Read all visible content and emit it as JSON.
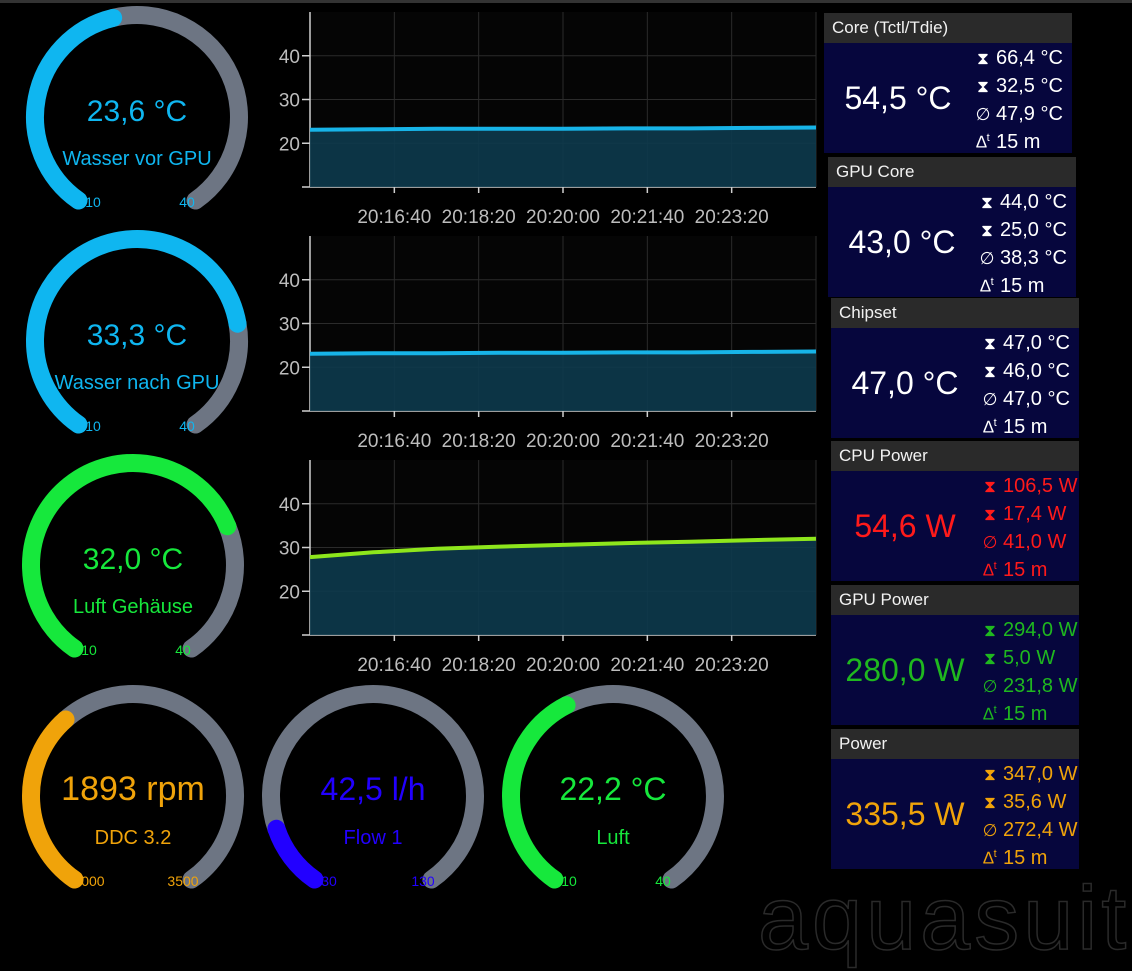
{
  "colors": {
    "blue": "#0fb6f0",
    "green": "#16e83c",
    "orange": "#f0a30a",
    "flow_blue": "#2200ff",
    "track": "#6d7583",
    "stat_white": "#ffffff",
    "stat_red": "#ff1a1a",
    "stat_green": "#1fb81f",
    "stat_orange": "#f0a30a",
    "chart_line_blue": "#17b4e8",
    "chart_line_green": "#8ee61c",
    "chart_fill": "#0d3a4c",
    "panel_bg": "#06063d",
    "panel_header": "#2a2a2a"
  },
  "gauges": [
    {
      "value_text": "23,6 °C",
      "label": "Wasser vor GPU",
      "min_label": "10",
      "max_label": "40",
      "min": 10,
      "max": 40,
      "value": 23.6,
      "color": "blue"
    },
    {
      "value_text": "33,3 °C",
      "label": "Wasser nach GPU",
      "min_label": "10",
      "max_label": "40",
      "min": 10,
      "max": 40,
      "value": 33.3,
      "color": "blue"
    },
    {
      "value_text": "32,0 °C",
      "label": "Luft Gehäuse",
      "min_label": "10",
      "max_label": "40",
      "min": 10,
      "max": 40,
      "value": 32.0,
      "color": "green"
    },
    {
      "value_text": "1893 rpm",
      "label": "DDC 3.2",
      "min_label": "1000",
      "max_label": "3500",
      "min": 1000,
      "max": 3500,
      "value": 1893,
      "color": "orange"
    },
    {
      "value_text": "42,5 l/h",
      "label": "Flow 1",
      "min_label": "30",
      "max_label": "130",
      "min": 30,
      "max": 130,
      "value": 42.5,
      "color": "flow_blue"
    },
    {
      "value_text": "22,2 °C",
      "label": "Luft",
      "min_label": "10",
      "max_label": "40",
      "min": 10,
      "max": 40,
      "value": 22.2,
      "color": "green"
    }
  ],
  "chart_data": [
    {
      "type": "area",
      "series": [
        {
          "values": [
            23.1,
            23.2,
            23.3,
            23.3,
            23.3,
            23.4,
            23.4,
            23.5,
            23.6
          ]
        }
      ],
      "x": [
        "20:15:00",
        "20:16:40",
        "20:18:20",
        "20:20:00",
        "20:21:40",
        "20:23:20",
        "20:25:00"
      ],
      "x_tick_labels": [
        "20:16:40",
        "20:18:20",
        "20:20:00",
        "20:21:40",
        "20:23:20"
      ],
      "y_tick_labels": [
        "20",
        "30",
        "40"
      ],
      "ylim": [
        10,
        50
      ],
      "grid": true,
      "line_color": "chart_line_blue"
    },
    {
      "type": "area",
      "series": [
        {
          "values": [
            23.1,
            23.2,
            23.2,
            23.3,
            23.3,
            23.4,
            23.4,
            23.5,
            23.6
          ]
        }
      ],
      "x_tick_labels": [
        "20:16:40",
        "20:18:20",
        "20:20:00",
        "20:21:40",
        "20:23:20"
      ],
      "y_tick_labels": [
        "20",
        "30",
        "40"
      ],
      "ylim": [
        10,
        50
      ],
      "grid": true,
      "line_color": "chart_line_blue"
    },
    {
      "type": "area",
      "series": [
        {
          "values": [
            27.8,
            28.9,
            29.7,
            30.2,
            30.6,
            31.0,
            31.3,
            31.7,
            32.0
          ]
        }
      ],
      "x_tick_labels": [
        "20:16:40",
        "20:18:20",
        "20:20:00",
        "20:21:40",
        "20:23:20"
      ],
      "y_tick_labels": [
        "20",
        "30",
        "40"
      ],
      "ylim": [
        10,
        50
      ],
      "grid": true,
      "line_color": "chart_line_green"
    }
  ],
  "panels": [
    {
      "title": "Core (Tctl/Tdie)",
      "value": "54,5 °C",
      "max": "66,4 °C",
      "min": "32,5 °C",
      "avg": "47,9 °C",
      "span": "15 m",
      "color": "stat_white"
    },
    {
      "title": "GPU Core",
      "value": "43,0 °C",
      "max": "44,0 °C",
      "min": "25,0 °C",
      "avg": "38,3 °C",
      "span": "15 m",
      "color": "stat_white"
    },
    {
      "title": "Chipset",
      "value": "47,0 °C",
      "max": "47,0 °C",
      "min": "46,0 °C",
      "avg": "47,0 °C",
      "span": "15 m",
      "color": "stat_white"
    },
    {
      "title": "CPU Power",
      "value": "54,6 W",
      "max": "106,5 W",
      "min": "17,4 W",
      "avg": "41,0 W",
      "span": "15 m",
      "color": "stat_red"
    },
    {
      "title": "GPU Power",
      "value": "280,0 W",
      "max": "294,0 W",
      "min": "5,0 W",
      "avg": "231,8 W",
      "span": "15 m",
      "color": "stat_green"
    },
    {
      "title": "Power",
      "value": "335,5 W",
      "max": "347,0 W",
      "min": "35,6 W",
      "avg": "272,4 W",
      "span": "15 m",
      "color": "stat_orange"
    }
  ],
  "stat_icons": {
    "max": "hourglass-max-icon",
    "min": "hourglass-min-icon",
    "avg": "average-icon",
    "span": "delta-time-icon"
  },
  "stat_glyphs": {
    "max": "⧗",
    "min": "⧗",
    "avg": "∅",
    "delta": "∆",
    "t": "t"
  },
  "watermark": "aquasuite"
}
